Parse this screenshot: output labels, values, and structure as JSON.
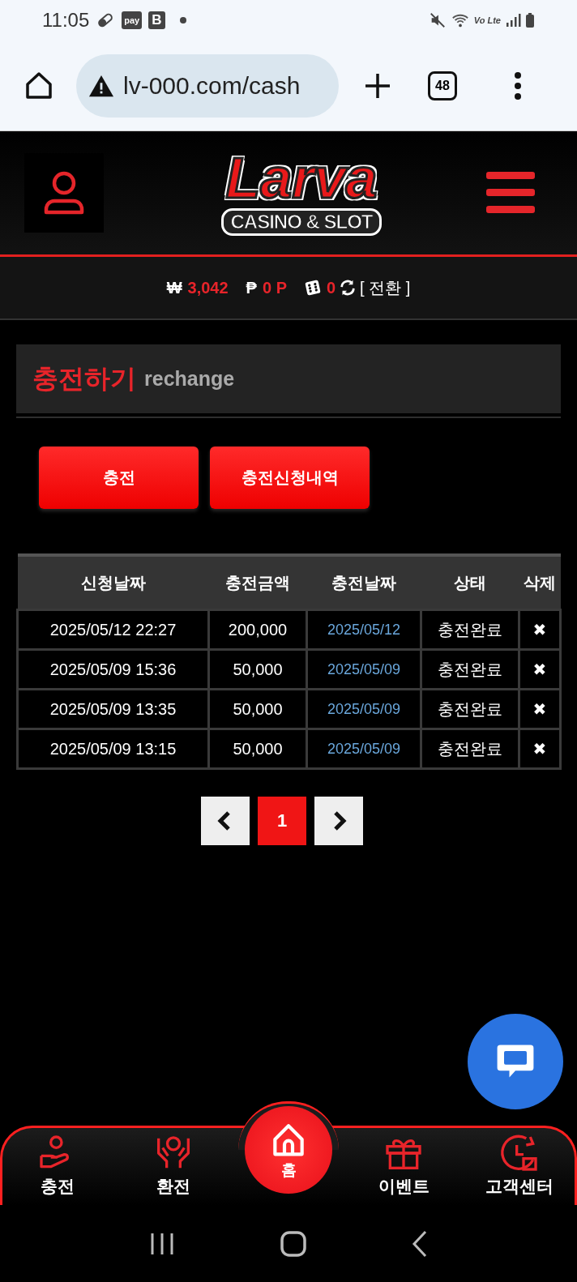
{
  "status_bar": {
    "time": "11:05",
    "notification_badges": [
      "pay",
      "B"
    ],
    "network_label": "Vo Lte"
  },
  "browser": {
    "url": "lv-000.com/cash",
    "tab_count": "48"
  },
  "header": {
    "logo": {
      "title": "Larva",
      "subtitle": "CASINO & SLOT"
    }
  },
  "balance": {
    "items": [
      {
        "kind": "cash",
        "symbol": "₩",
        "value": "3,042"
      },
      {
        "kind": "point",
        "symbol": "₱",
        "value": "0 P"
      },
      {
        "kind": "dice",
        "value": "0"
      }
    ],
    "convert": "[ 전환 ]"
  },
  "section": {
    "title": "충전하기",
    "subtitle": "rechange"
  },
  "buttons": [
    "충전",
    "충전신청내역"
  ],
  "table": {
    "columns": [
      "신청날짜",
      "충전금액",
      "충전날짜",
      "상태",
      "삭제"
    ],
    "rows": [
      {
        "requested": "2025/05/12 22:27",
        "amount": "200,000",
        "charged": "2025/05/12",
        "status": "충전완료",
        "delete": "✖"
      },
      {
        "requested": "2025/05/09 15:36",
        "amount": "50,000",
        "charged": "2025/05/09",
        "status": "충전완료",
        "delete": "✖"
      },
      {
        "requested": "2025/05/09 13:35",
        "amount": "50,000",
        "charged": "2025/05/09",
        "status": "충전완료",
        "delete": "✖"
      },
      {
        "requested": "2025/05/09 13:15",
        "amount": "50,000",
        "charged": "2025/05/09",
        "status": "충전완료",
        "delete": "✖"
      }
    ]
  },
  "pagination": {
    "pages": [
      {
        "label": "1",
        "selected": true
      }
    ]
  },
  "bottom_nav": [
    {
      "label": "충전",
      "kind": "tab"
    },
    {
      "label": "환전",
      "kind": "tab"
    },
    {
      "label": "홈",
      "kind": "center"
    },
    {
      "label": "이벤트",
      "kind": "tab"
    },
    {
      "label": "고객센터",
      "kind": "tab"
    }
  ]
}
